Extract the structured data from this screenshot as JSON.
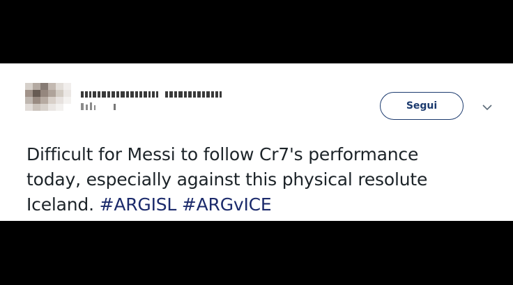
{
  "tweet": {
    "follow_label": "Segui",
    "text_line1": "Difficult for Messi to follow Cr7's performance",
    "text_line2": "today, especially against this physical resolute",
    "text_line3_prefix": "Iceland.",
    "hashtags": [
      "#ARGISL",
      "#ARGvICE"
    ]
  },
  "icons": {
    "menu_icon": "chevron-down-icon"
  },
  "colors": {
    "accent": "#1b3a6e",
    "hashtag": "#1b2a6b",
    "text": "#1c2328",
    "background": "#000000",
    "card": "#ffffff"
  }
}
